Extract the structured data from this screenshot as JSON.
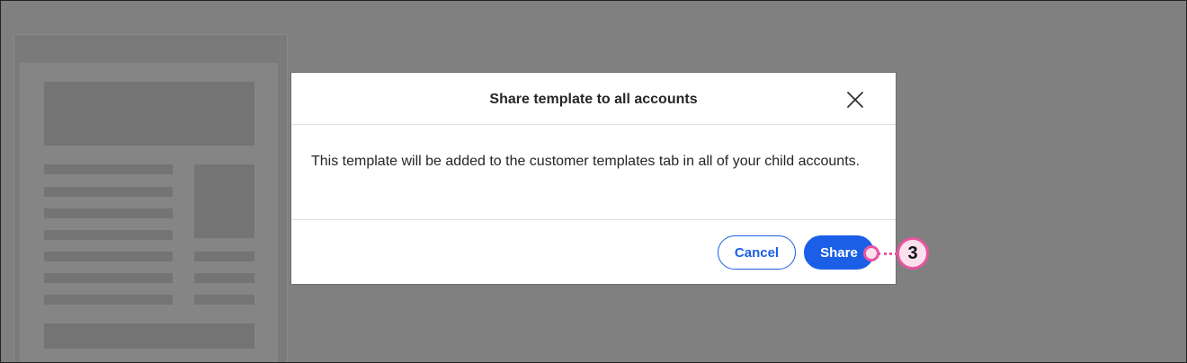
{
  "dialog": {
    "title": "Share template to all accounts",
    "message": "This template will be added to the customer templates tab in all of your child accounts.",
    "close_icon": "close-icon"
  },
  "buttons": {
    "cancel_label": "Cancel",
    "share_label": "Share"
  },
  "callout": {
    "step_number": "3",
    "color": "#e8559f"
  },
  "colors": {
    "primary": "#1a5fe6",
    "overlay": "#808080"
  }
}
